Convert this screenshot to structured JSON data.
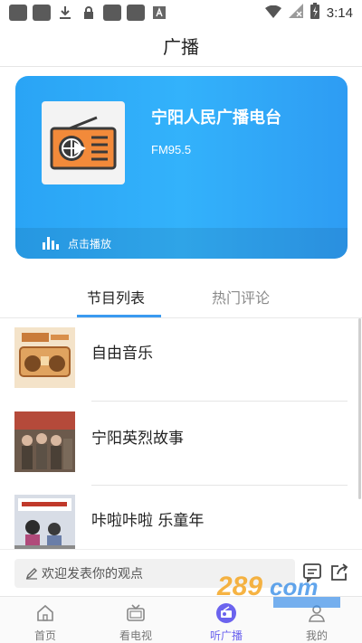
{
  "status_bar": {
    "time": "3:14"
  },
  "header": {
    "title": "广播"
  },
  "station": {
    "name": "宁阳人民广播电台",
    "frequency": "FM95.5",
    "play_label": "点击播放"
  },
  "tabs": [
    {
      "label": "节目列表",
      "active": true
    },
    {
      "label": "热门评论",
      "active": false
    }
  ],
  "programs": [
    {
      "name": "自由音乐"
    },
    {
      "name": "宁阳英烈故事"
    },
    {
      "name": "咔啦咔啦 乐童年"
    }
  ],
  "comment": {
    "placeholder": "欢迎发表你的观点"
  },
  "nav": {
    "items": [
      {
        "label": "首页",
        "active": false
      },
      {
        "label": "看电视",
        "active": false
      },
      {
        "label": "听广播",
        "active": true
      },
      {
        "label": "我的",
        "active": false
      }
    ]
  },
  "colors": {
    "accent": "#3a9af0",
    "nav_active": "#6b63ee",
    "hero": "#33b2fb"
  }
}
